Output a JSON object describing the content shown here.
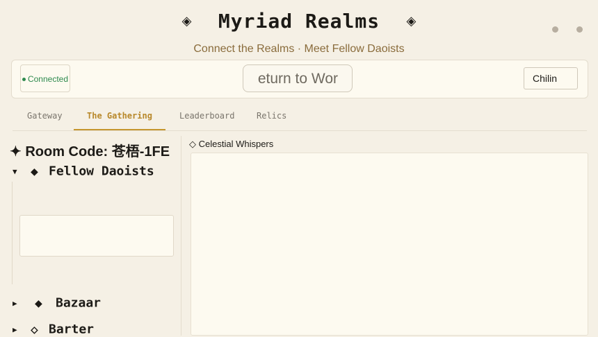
{
  "header": {
    "title": "Myriad Realms",
    "title_ornament": "◈",
    "subtitle": "Connect the Realms · Meet Fellow Daoists"
  },
  "topbar": {
    "status_label": "Connected",
    "return_button_visible": "eturn to Wor",
    "name_value": "Chilin"
  },
  "tabs": [
    {
      "label": "Gateway"
    },
    {
      "label": "The Gathering",
      "active": true
    },
    {
      "label": "Leaderboard"
    },
    {
      "label": "Relics"
    }
  ],
  "sidebar": {
    "room_code": "✦ Room Code: 苍梧-1FE",
    "sections": [
      {
        "caret": "▼",
        "icon": "◆",
        "label": "Fellow Daoists"
      },
      {
        "caret": "▶",
        "icon": "◆",
        "label": "Bazaar"
      },
      {
        "caret": "▶",
        "icon": "◇",
        "label": "Barter"
      }
    ]
  },
  "chat": {
    "label": "◇ Celestial Whispers"
  },
  "colors": {
    "background": "#f5f0e5",
    "accent": "#c5962e",
    "connected": "#2e8a4e",
    "subtitle": "#8a6c3c"
  }
}
